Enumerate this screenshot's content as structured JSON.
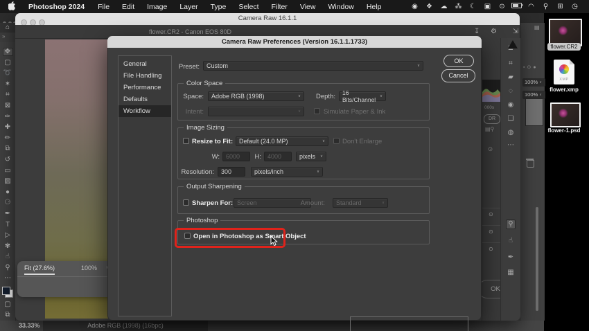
{
  "menubar": {
    "app_name": "Photoshop 2024",
    "menus": [
      "File",
      "Edit",
      "Image",
      "Layer",
      "Type",
      "Select",
      "Filter",
      "View",
      "Window",
      "Help"
    ]
  },
  "camera_raw": {
    "window_title": "Camera Raw 16.1.1",
    "doc_title": "flower.CR2  -  Canon EOS 80D",
    "zoom_fit_label": "Fit (27.6%)",
    "zoom_100_label": "100%",
    "ok_label": "OK",
    "panel_sliver": {
      "shutter": "000s",
      "hdr": "DR"
    }
  },
  "dialog": {
    "title": "Camera Raw Preferences  (Version 16.1.1.1733)",
    "ok": "OK",
    "cancel": "Cancel",
    "sidebar": [
      "General",
      "File Handling",
      "Performance",
      "Defaults",
      "Workflow"
    ],
    "preset_label": "Preset:",
    "preset_value": "Custom",
    "color_space": {
      "legend": "Color Space",
      "space_label": "Space:",
      "space_value": "Adobe RGB (1998)",
      "depth_label": "Depth:",
      "depth_value": "16 Bits/Channel",
      "intent_label": "Intent:",
      "simulate_label": "Simulate Paper & Ink"
    },
    "image_sizing": {
      "legend": "Image Sizing",
      "resize_label": "Resize to Fit:",
      "resize_value": "Default (24.0 MP)",
      "dont_enlarge_label": "Don't Enlarge",
      "w_label": "W:",
      "w_value": "6000",
      "h_label": "H:",
      "h_value": "4000",
      "unit_value": "pixels",
      "resolution_label": "Resolution:",
      "resolution_value": "300",
      "resolution_unit": "pixels/inch"
    },
    "output_sharpening": {
      "legend": "Output Sharpening",
      "sharpen_label": "Sharpen For:",
      "sharpen_value": "Screen",
      "amount_label": "Amount:",
      "amount_value": "Standard"
    },
    "photoshop": {
      "legend": "Photoshop",
      "smart_object_label": "Open in Photoshop as Smart Object"
    }
  },
  "layers_strip": {
    "opacity": "100%",
    "fill": "100%"
  },
  "status_bar": {
    "zoom_level": "33.33%",
    "color_profile": "Adobe RGB (1998) (16bpc)"
  },
  "desktop": {
    "files": [
      {
        "label": "flower.CR2"
      },
      {
        "label": "flower.xmp",
        "badge": "XMP"
      },
      {
        "label": "flower-1.psd"
      }
    ]
  },
  "colors": {
    "highlight_red": "#e0231b",
    "dialog_titlebar": "#d7d7d7",
    "menubar_bg": "#191919",
    "panel_bg": "#3d3d3d"
  },
  "icons": {
    "record": "◉",
    "dropbox": "❖",
    "creative_cloud": "☁",
    "sparkle": "⁂",
    "moon": "☾",
    "display": "▣",
    "play": "⊙",
    "wifi": "◠",
    "search": "⚲",
    "control_center": "⊞",
    "clock": "◷",
    "home": "⌂",
    "chevrons": "»",
    "move_tool": "✥",
    "marquee_tool": "▢",
    "lasso_tool": "➰",
    "magic_wand_tool": "✶",
    "crop_tool": "⌗",
    "frame_tool": "⊠",
    "eyedropper_tool": "✑",
    "healing_tool": "✚",
    "brush_tool": "✏",
    "clone_stamp_tool": "⧉",
    "history_brush_tool": "↺",
    "eraser_tool": "▭",
    "gradient_tool": "▨",
    "blur_tool": "●",
    "dodge_tool": "⚆",
    "pen_tool": "✒",
    "type_tool": "T",
    "path_select_tool": "▷",
    "shape_tool": "✾",
    "hand_tool": "☝",
    "zoom_tool": "⚲",
    "more_tools": "⋯",
    "save_icon": "↧",
    "gear_icon": "⚙",
    "expand_icon": "⇲",
    "edit_icon": "≣",
    "cr_crop_icon": "⌗",
    "cr_heal_icon": "▰",
    "mask_icon": "◌",
    "redeye_icon": "◉",
    "presets_icon": "❏",
    "blend_icon": "◍",
    "cr_more_icon": "⋯",
    "cr_zoom_icon": "⚲",
    "cr_hand_icon": "☝",
    "wb_eyedropper_icon": "✒",
    "grid_icon": "▦",
    "eye_icon": "⊙",
    "chevron_down": "∨",
    "panel_icon": "▤",
    "lock_icon": "▪"
  }
}
